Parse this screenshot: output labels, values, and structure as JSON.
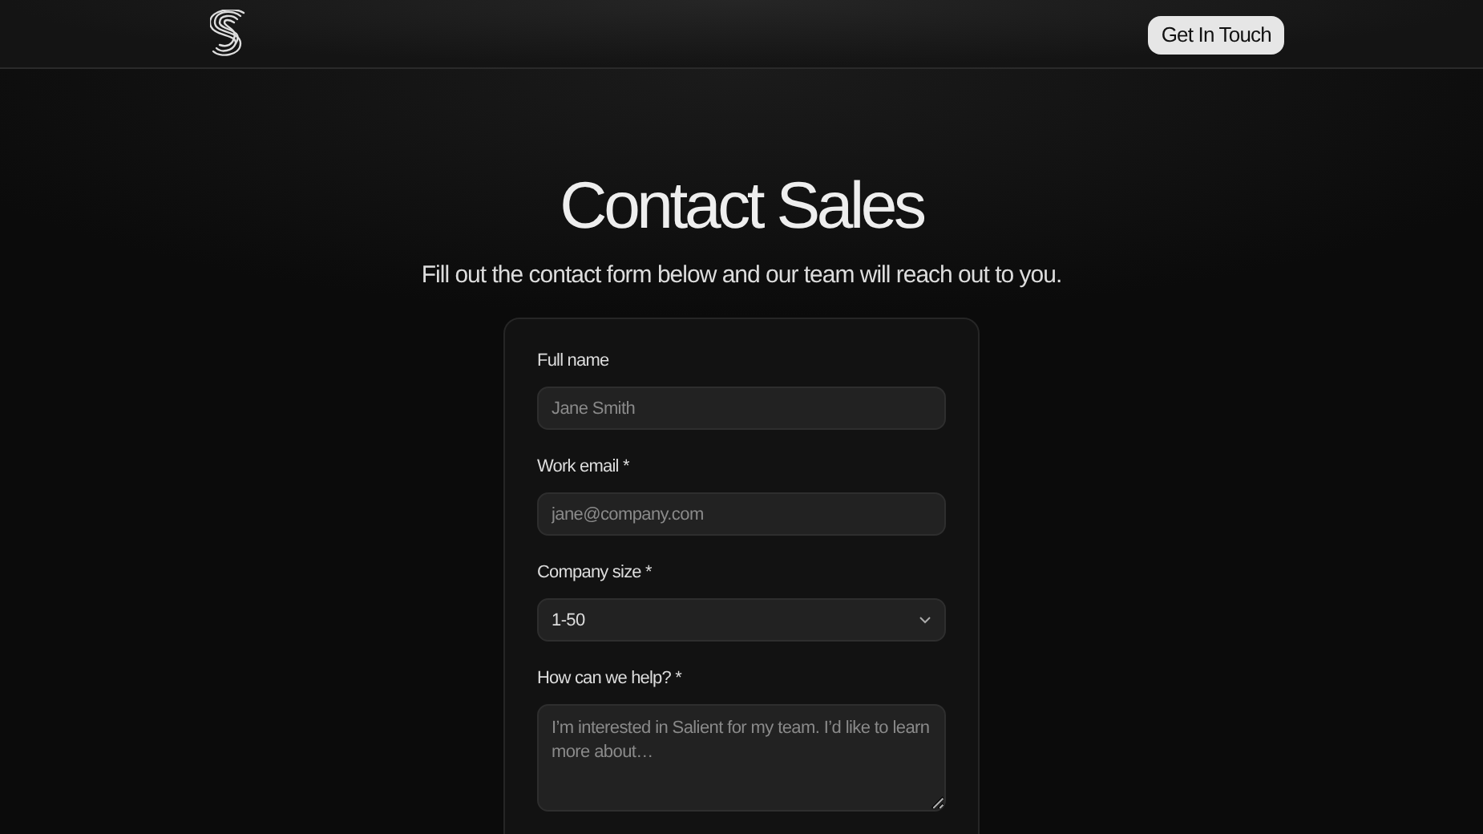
{
  "header": {
    "button": "Get In Touch"
  },
  "hero": {
    "title": "Contact Sales",
    "subtitle": "Fill out the contact form below and our team will reach out to you."
  },
  "form": {
    "fields": [
      {
        "kind": "text",
        "label": "Full name",
        "placeholder": "Jane Smith"
      },
      {
        "kind": "text",
        "label": "Work email *",
        "placeholder": "jane@company.com"
      },
      {
        "kind": "select",
        "label": "Company size *",
        "value": "1-50"
      },
      {
        "kind": "textarea",
        "label": "How can we help? *",
        "placeholder": "I’m interested in Salient for my team. I’d like to learn more about…"
      }
    ]
  }
}
